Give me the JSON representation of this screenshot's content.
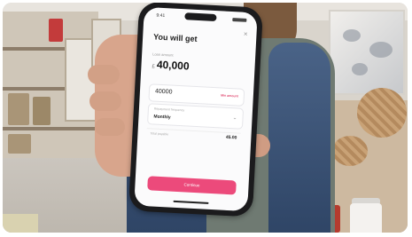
{
  "phone": {
    "title": "You will get",
    "amount_label": "Loan amount",
    "currency": "£",
    "amount_value": "40,000",
    "field1_value": "40000",
    "field1_tag": "Min amount",
    "field2_label": "Repayment frequency",
    "field2_value": "Monthly",
    "row3_label": "Total payable",
    "row3_value": "45.00",
    "cta_label": "Continue",
    "status_time": "9:41",
    "close_glyph": "×",
    "chevron_glyph": "⌄"
  },
  "colors": {
    "accent": "#ec4a7b",
    "jacket": "#3a5075",
    "shirt": "#6f7a72"
  }
}
